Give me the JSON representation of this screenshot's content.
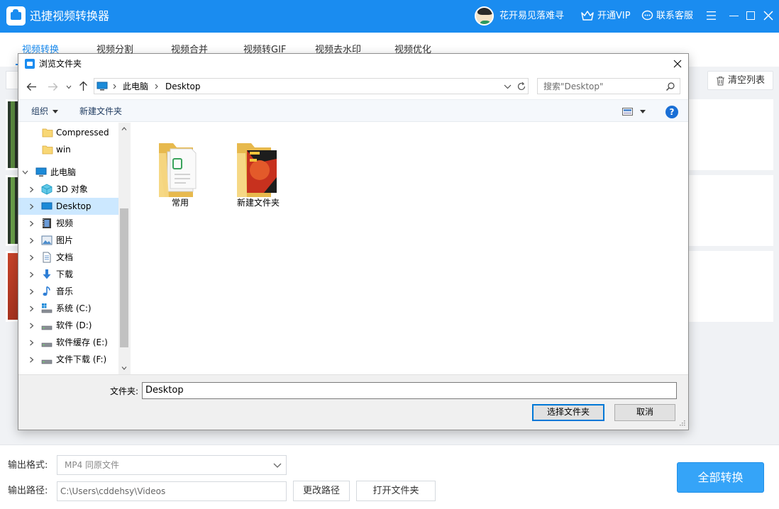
{
  "app": {
    "title": "迅捷视频转换器",
    "user_name": "花开易见落难寻",
    "vip_label": "开通VIP",
    "service_label": "联系客服",
    "brand_color": "#1a8cf0"
  },
  "tabs": [
    {
      "label": "视频转换",
      "active": true
    },
    {
      "label": "视频分割",
      "active": false
    },
    {
      "label": "视频合并",
      "active": false
    },
    {
      "label": "视频转GIF",
      "active": false
    },
    {
      "label": "视频去水印",
      "active": false
    },
    {
      "label": "视频优化",
      "active": false
    }
  ],
  "toolbar": {
    "clear_list_label": "清空列表"
  },
  "bottom": {
    "format_label": "输出格式:",
    "format_value": "MP4  同原文件",
    "path_label": "输出路径:",
    "path_value": "C:\\Users\\cddehsy\\Videos",
    "change_path_label": "更改路径",
    "open_folder_label": "打开文件夹",
    "convert_all_label": "全部转换"
  },
  "dialog": {
    "title": "浏览文件夹",
    "address": {
      "root": "此电脑",
      "current": "Desktop"
    },
    "search_placeholder": "搜索\"Desktop\"",
    "commands": {
      "organize": "组织",
      "new_folder": "新建文件夹"
    },
    "help_glyph": "?",
    "tree": [
      {
        "label": "Compressed",
        "icon": "folder-icon",
        "level": 2,
        "expandable": false,
        "selected": false
      },
      {
        "label": "win",
        "icon": "folder-icon",
        "level": 2,
        "expandable": false,
        "selected": false
      },
      {
        "label": "此电脑",
        "icon": "computer-icon",
        "level": 1,
        "expandable": true,
        "expanded": true,
        "selected": false
      },
      {
        "label": "3D 对象",
        "icon": "cube-3d-icon",
        "level": 2,
        "expandable": true,
        "selected": false
      },
      {
        "label": "Desktop",
        "icon": "desktop-icon",
        "level": 2,
        "expandable": true,
        "selected": true
      },
      {
        "label": "视频",
        "icon": "video-icon",
        "level": 2,
        "expandable": true,
        "selected": false
      },
      {
        "label": "图片",
        "icon": "picture-icon",
        "level": 2,
        "expandable": true,
        "selected": false
      },
      {
        "label": "文档",
        "icon": "document-icon",
        "level": 2,
        "expandable": true,
        "selected": false
      },
      {
        "label": "下载",
        "icon": "download-icon",
        "level": 2,
        "expandable": true,
        "selected": false
      },
      {
        "label": "音乐",
        "icon": "music-icon",
        "level": 2,
        "expandable": true,
        "selected": false
      },
      {
        "label": "系统 (C:)",
        "icon": "system-drive-icon",
        "level": 2,
        "expandable": true,
        "selected": false
      },
      {
        "label": "软件 (D:)",
        "icon": "drive-icon",
        "level": 2,
        "expandable": true,
        "selected": false
      },
      {
        "label": "软件缓存 (E:)",
        "icon": "drive-icon",
        "level": 2,
        "expandable": true,
        "selected": false
      },
      {
        "label": "文件下载 (F:)",
        "icon": "drive-icon",
        "level": 2,
        "expandable": true,
        "selected": false
      }
    ],
    "files": [
      {
        "label": "常用",
        "icon": "folder-documents-icon"
      },
      {
        "label": "新建文件夹",
        "icon": "folder-image-icon"
      }
    ],
    "folder_label": "文件夹:",
    "folder_value": "Desktop",
    "select_button": "选择文件夹",
    "cancel_button": "取消"
  }
}
